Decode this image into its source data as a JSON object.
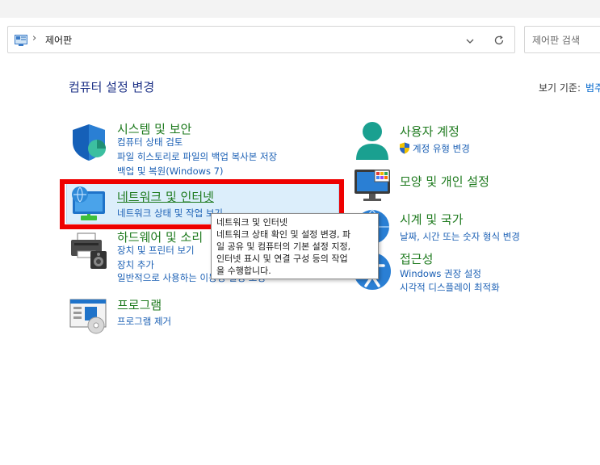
{
  "address": {
    "path_label": "제어판"
  },
  "search": {
    "placeholder": "제어판 검색"
  },
  "page": {
    "heading": "컴퓨터 설정 변경",
    "view_by_label": "보기 기준:",
    "view_by_value": "범주"
  },
  "categories": {
    "system": {
      "title": "시스템 및 보안",
      "links": [
        "컴퓨터 상태 검토",
        "파일 히스토리로 파일의 백업 복사본 저장",
        "백업 및 복원(Windows 7)"
      ]
    },
    "network": {
      "title": "네트워크 및 인터넷",
      "links": [
        "네트워크 상태 및 작업 보기"
      ]
    },
    "hardware": {
      "title": "하드웨어 및 소리",
      "links": [
        "장치 및 프린터 보기",
        "장치 추가",
        "일반적으로 사용하는 이동성 설정 조정"
      ]
    },
    "programs": {
      "title": "프로그램",
      "links": [
        "프로그램 제거"
      ]
    },
    "accounts": {
      "title": "사용자 계정",
      "links": [
        "계정 유형 변경"
      ]
    },
    "appearance": {
      "title": "모양 및 개인 설정",
      "links": []
    },
    "clock": {
      "title": "시계 및 국가",
      "links": [
        "날짜, 시간 또는 숫자 형식 변경"
      ]
    },
    "ease": {
      "title": "접근성",
      "links": [
        "Windows 권장 설정",
        "시각적 디스플레이 최적화"
      ]
    }
  },
  "tooltip": {
    "lines": [
      "네트워크 및 인터넷",
      "네트워크 상태 확인 및 설정 변경, 파",
      "일 공유 및 컴퓨터의 기본 설정 지정,",
      "인터넷 표시 및 연결 구성 등의 작업",
      "을 수행합니다."
    ]
  },
  "colors": {
    "category_title": "#1e7a1e",
    "link": "#1a5fb4",
    "heading": "#1e3287",
    "highlight_border": "#ee0000",
    "hover_background": "#dceefb"
  }
}
